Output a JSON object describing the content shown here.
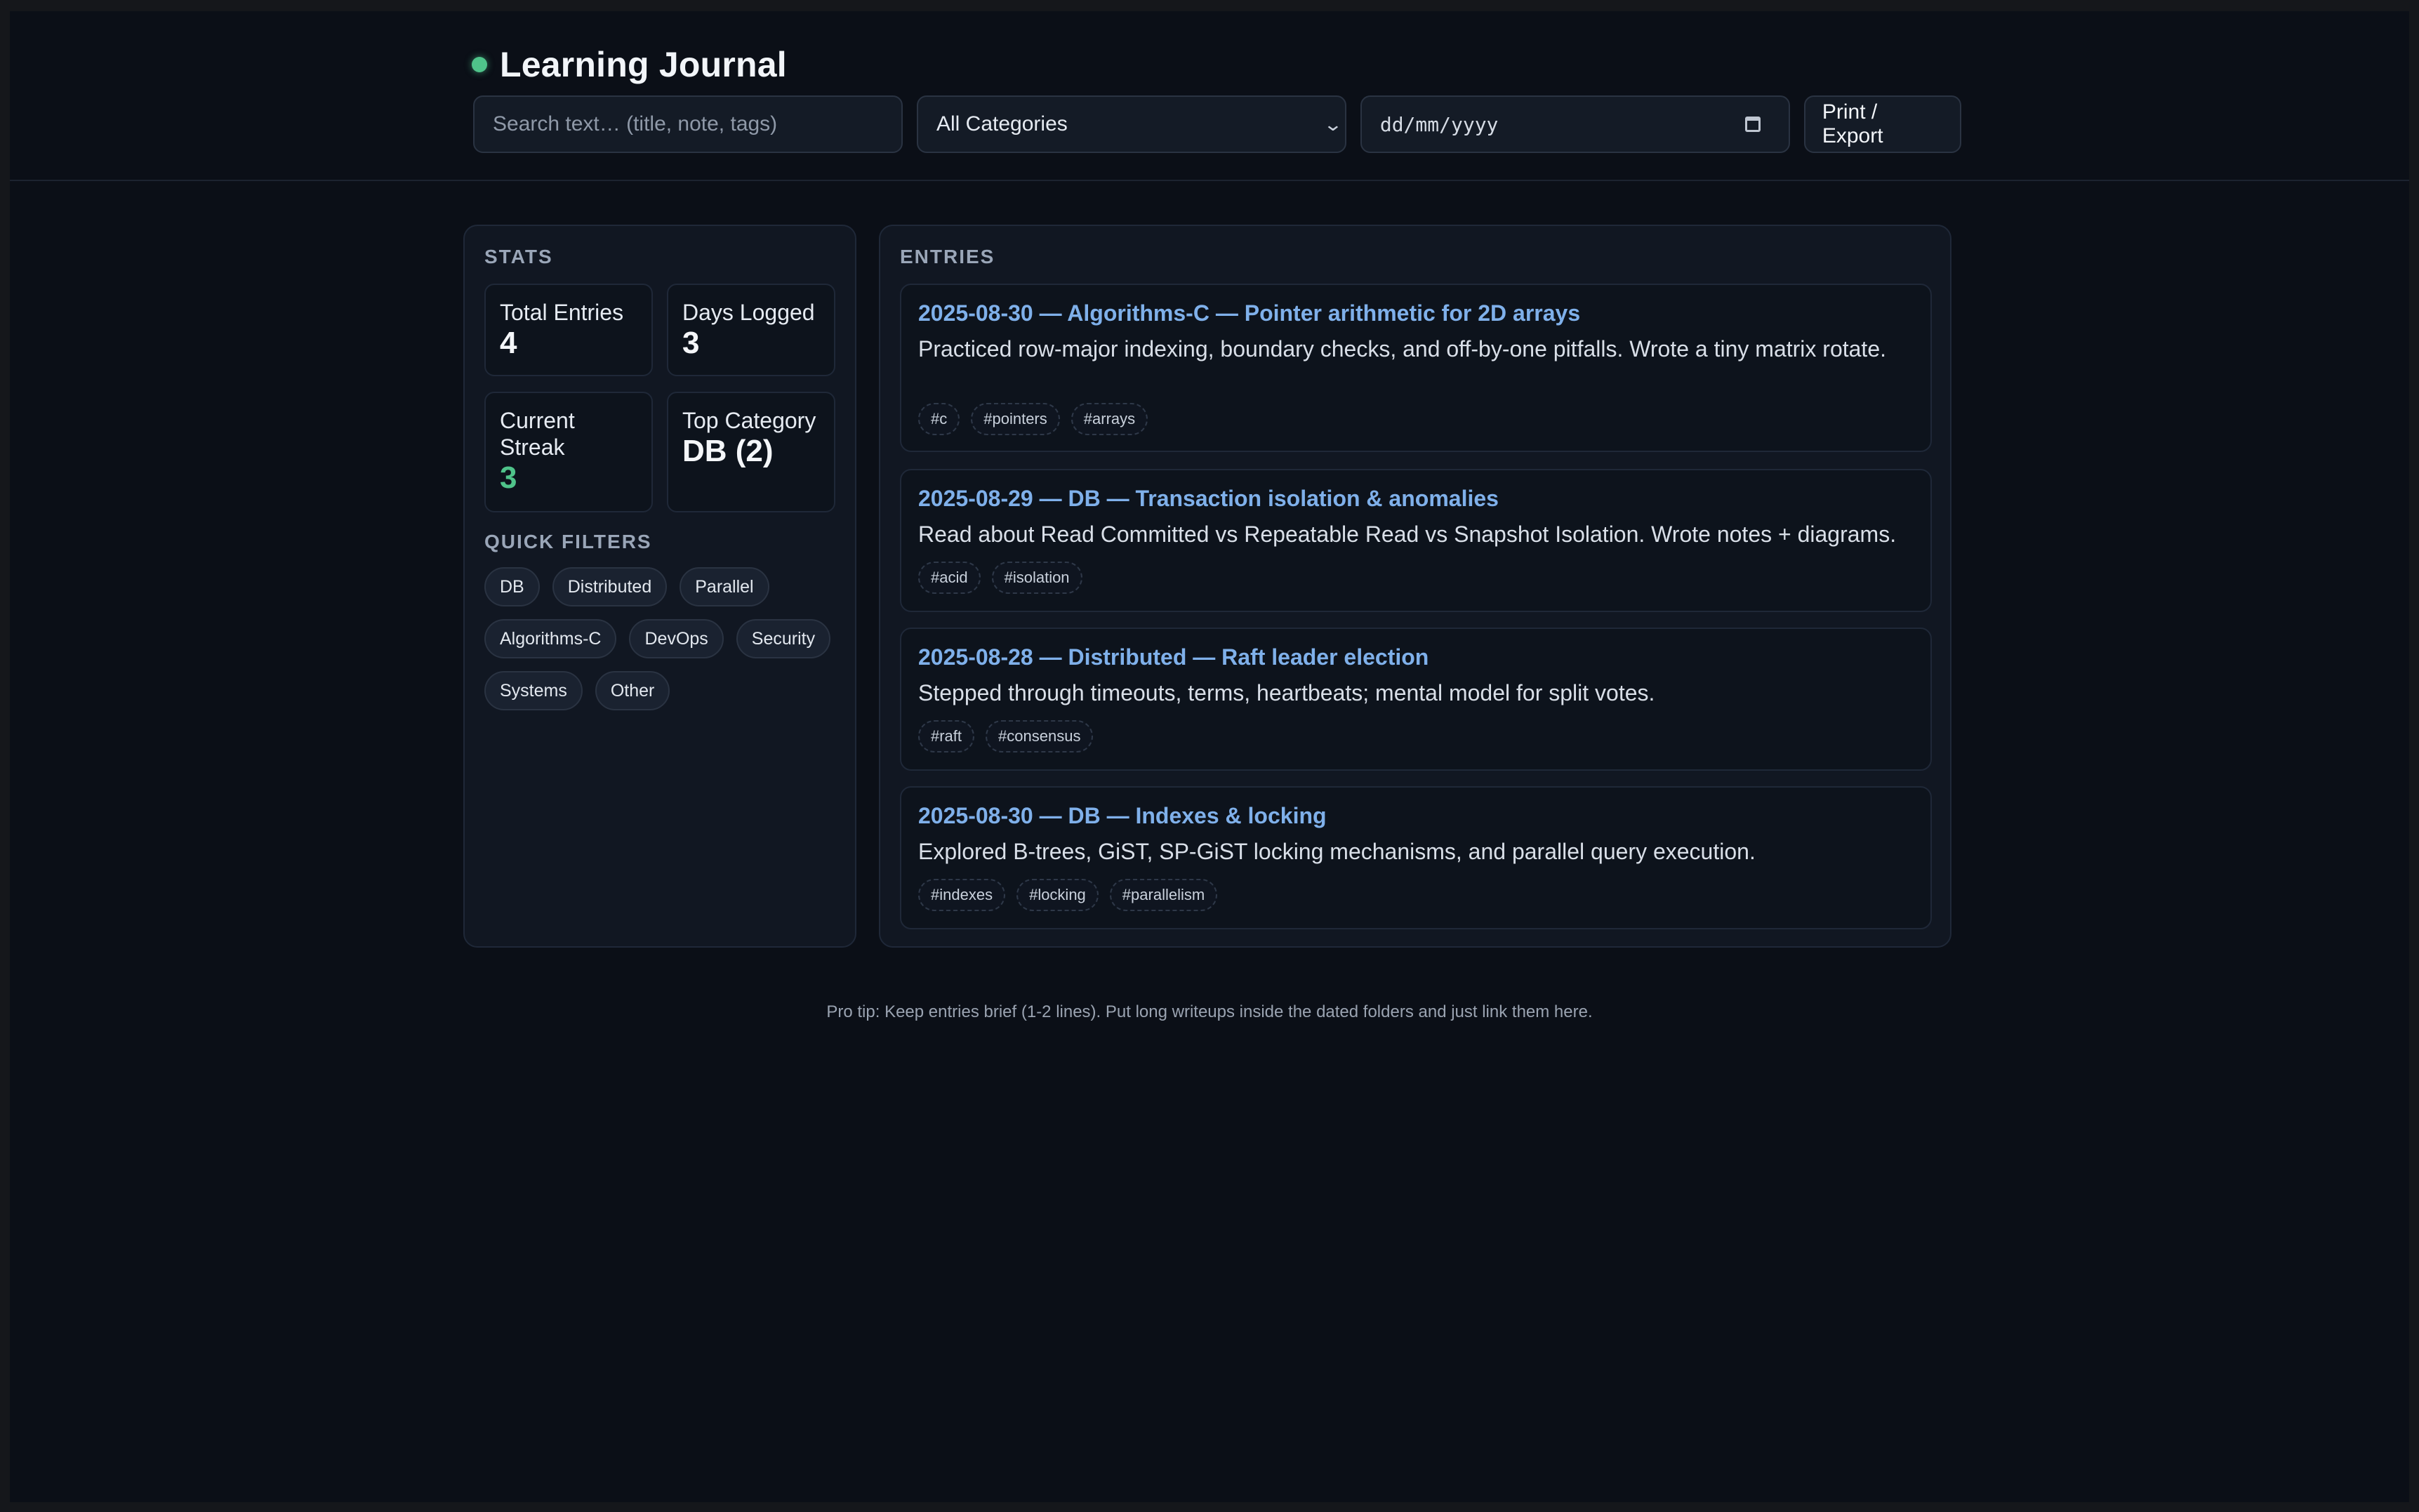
{
  "app": {
    "title": "Learning Journal"
  },
  "toolbar": {
    "search_placeholder": "Search text… (title, note, tags)",
    "category_selected": "All Categories",
    "date_placeholder": "dd/mm/yyyy",
    "export_label": "Print / Export"
  },
  "stats": {
    "heading": "STATS",
    "cards": [
      {
        "label": "Total Entries",
        "value": "4"
      },
      {
        "label": "Days Logged",
        "value": "3"
      },
      {
        "label": "Current Streak",
        "value": "3"
      },
      {
        "label": "Top Category",
        "value": "DB (2)"
      }
    ],
    "quick_filters_heading": "QUICK FILTERS",
    "quick_filters": [
      "DB",
      "Distributed",
      "Parallel",
      "Algorithms-C",
      "DevOps",
      "Security",
      "Systems",
      "Other"
    ]
  },
  "entries": {
    "heading": "ENTRIES",
    "items": [
      {
        "title": "2025-08-30 — Algorithms-C — Pointer arithmetic for 2D arrays",
        "note": "Practiced row-major indexing, boundary checks, and off-by-one pitfalls. Wrote a tiny matrix rotate.",
        "tags": [
          "#c",
          "#pointers",
          "#arrays"
        ]
      },
      {
        "title": "2025-08-29 — DB — Transaction isolation & anomalies",
        "note": "Read about Read Committed vs Repeatable Read vs Snapshot Isolation. Wrote notes + diagrams.",
        "tags": [
          "#acid",
          "#isolation"
        ]
      },
      {
        "title": "2025-08-28 — Distributed — Raft leader election",
        "note": "Stepped through timeouts, terms, heartbeats; mental model for split votes.",
        "tags": [
          "#raft",
          "#consensus"
        ]
      },
      {
        "title": "2025-08-30 — DB — Indexes & locking",
        "note": "Explored B-trees, GiST, SP-GiST locking mechanisms, and parallel query execution.",
        "tags": [
          "#indexes",
          "#locking",
          "#parallelism"
        ]
      }
    ]
  },
  "footer": {
    "tip": "Pro tip: Keep entries brief (1-2 lines). Put long writeups inside the dated folders and just link them here."
  },
  "colors": {
    "background": "#0b0f17",
    "panel": "#111722",
    "accent_green": "#4fc38a",
    "link_blue": "#7fb0ea"
  }
}
